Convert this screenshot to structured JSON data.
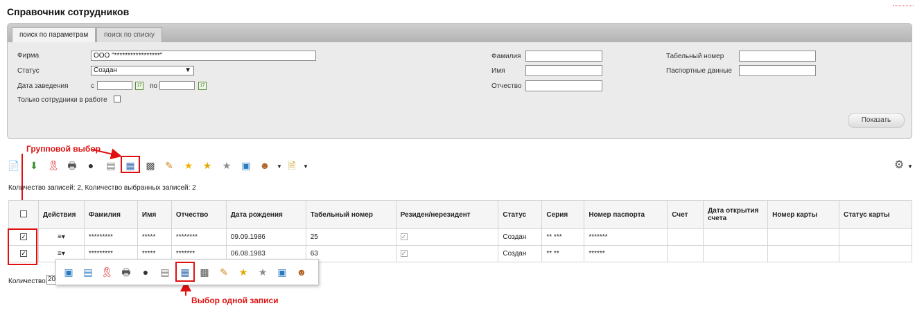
{
  "page": {
    "title": "Справочник сотрудников"
  },
  "tabs": {
    "by_params": "поиск по параметрам",
    "by_list": "поиск по списку"
  },
  "filters": {
    "firm_label": "Фирма",
    "firm_value": "ООО \"*****************\"",
    "status_label": "Статус",
    "status_value": "Создан",
    "date_label": "Дата заведения",
    "date_from_label": "с",
    "date_to_label": "по",
    "date_from_value": "",
    "date_to_value": "",
    "active_only_label": "Только сотрудники в работе",
    "lastname_label": "Фамилия",
    "firstname_label": "Имя",
    "middlename_label": "Отчество",
    "tabnum_label": "Табельный номер",
    "passport_label": "Паспортные данные",
    "show_button": "Показать"
  },
  "annotations": {
    "group_select": "Групповой выбор",
    "single_select": "Выбор одной записи"
  },
  "summary": "Количество записей: 2, Количество выбранных записей: 2",
  "table": {
    "columns": [
      "Действия",
      "Фамилия",
      "Имя",
      "Отчество",
      "Дата рождения",
      "Табельный номер",
      "Резиден/нерезидент",
      "Статус",
      "Серия",
      "Номер паспорта",
      "Счет",
      "Дата открытия счета",
      "Номер карты",
      "Статус карты"
    ],
    "rows": [
      {
        "lastname": "*********",
        "firstname": "*****",
        "middlename": "********",
        "birthdate": "09.09.1986",
        "tabnum": "25",
        "status": "Создан",
        "series": "** ***",
        "passport": "*******",
        "account": "",
        "account_date": "",
        "card": "",
        "card_status": ""
      },
      {
        "lastname": "*********",
        "firstname": "*****",
        "middlename": "*******",
        "birthdate": "06.08.1983",
        "tabnum": "63",
        "status": "Создан",
        "series": "** **",
        "passport": "******",
        "account": "",
        "account_date": "",
        "card": "",
        "card_status": ""
      }
    ]
  },
  "footer": {
    "count_label": "Количество:",
    "count_value": "20"
  },
  "icons": {
    "toolbar": [
      "new-document-icon",
      "download-icon",
      "award-ribbon-icon",
      "printer-icon",
      "user-status-icon",
      "id-card-icon",
      "group-select-icon",
      "card-delete-icon",
      "card-edit-icon",
      "star-icon",
      "star-add-icon",
      "star-gray-icon",
      "card-blue-icon",
      "users-icon",
      "document-icon",
      "settings-gear-icon"
    ],
    "row_menu": [
      "search-card-icon",
      "id-card-icon",
      "award-ribbon-icon",
      "printer-icon",
      "user-status-icon",
      "id-card-gray-icon",
      "single-select-icon",
      "card-delete-icon",
      "card-edit-icon",
      "star-add-icon",
      "star-gray-icon",
      "card-blue-icon",
      "users-icon"
    ]
  },
  "colors": {
    "annotation": "#e01010",
    "panel_bg": "#ebebeb"
  }
}
